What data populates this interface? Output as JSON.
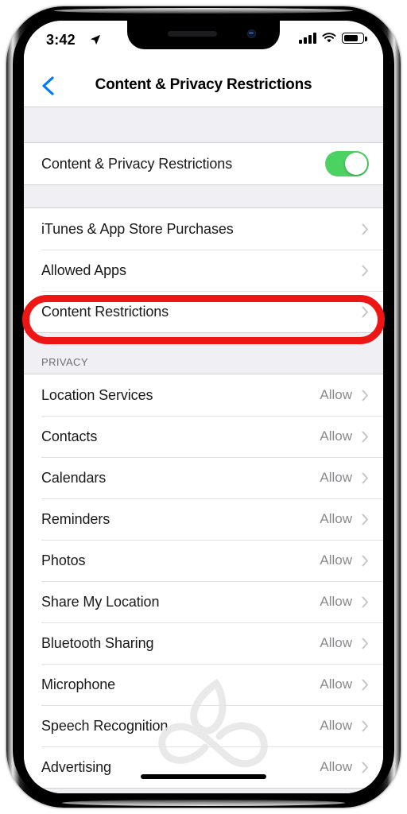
{
  "device": {
    "name": "iphone-x",
    "frame_color": "#000000",
    "accent_blue": "#007AFF",
    "toggle_green": "#4CD263",
    "highlight_red": "#EE1515",
    "screen_bg": "#EFEFF4"
  },
  "status_bar": {
    "time": "3:42",
    "location_icon": "location-arrow-icon",
    "signal_icon": "cellular-signal-icon",
    "signal_bars": 4,
    "wifi_icon": "wifi-icon",
    "battery_icon": "battery-icon",
    "battery_level_pct": 68
  },
  "nav_bar": {
    "back_icon": "chevron-left-icon",
    "title": "Content & Privacy Restrictions"
  },
  "master_toggle": {
    "label": "Content & Privacy Restrictions",
    "state": "on",
    "toggle_icon": "toggle-switch-on-icon"
  },
  "restrictions_group": {
    "rows": [
      {
        "label": "iTunes & App Store Purchases",
        "value": "",
        "chevron": "chevron-right-icon"
      },
      {
        "label": "Allowed Apps",
        "value": "",
        "chevron": "chevron-right-icon"
      },
      {
        "label": "Content Restrictions",
        "value": "",
        "chevron": "chevron-right-icon"
      }
    ]
  },
  "privacy_section": {
    "header": "PRIVACY",
    "rows": [
      {
        "label": "Location Services",
        "value": "Allow",
        "chevron": "chevron-right-icon"
      },
      {
        "label": "Contacts",
        "value": "Allow",
        "chevron": "chevron-right-icon"
      },
      {
        "label": "Calendars",
        "value": "Allow",
        "chevron": "chevron-right-icon"
      },
      {
        "label": "Reminders",
        "value": "Allow",
        "chevron": "chevron-right-icon"
      },
      {
        "label": "Photos",
        "value": "Allow",
        "chevron": "chevron-right-icon"
      },
      {
        "label": "Share My Location",
        "value": "Allow",
        "chevron": "chevron-right-icon"
      },
      {
        "label": "Bluetooth Sharing",
        "value": "Allow",
        "chevron": "chevron-right-icon"
      },
      {
        "label": "Microphone",
        "value": "Allow",
        "chevron": "chevron-right-icon"
      },
      {
        "label": "Speech Recognition",
        "value": "Allow",
        "chevron": "chevron-right-icon"
      },
      {
        "label": "Advertising",
        "value": "Allow",
        "chevron": "chevron-right-icon"
      }
    ]
  },
  "annotation": {
    "type": "red-oval-highlight",
    "targets_row_label": "Content Restrictions"
  },
  "watermark": {
    "icon": "infinity-leaf-watermark-icon"
  },
  "home_indicator": {
    "icon": "home-indicator-bar"
  }
}
